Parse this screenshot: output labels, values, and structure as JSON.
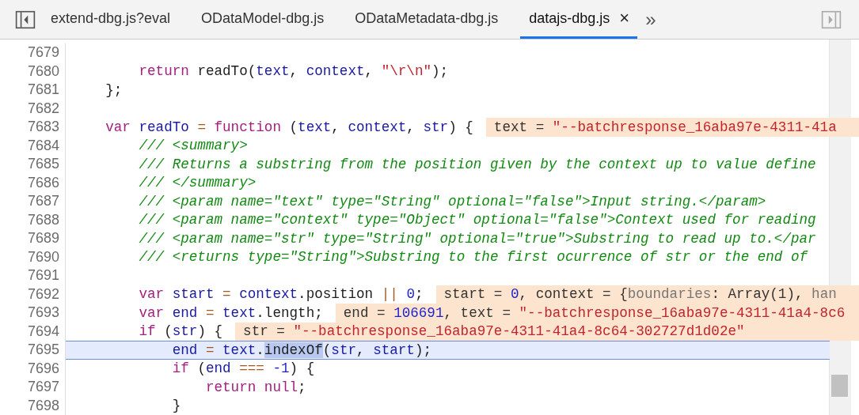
{
  "tabs": [
    {
      "label": "extend-dbg.js?eval",
      "selected": false
    },
    {
      "label": "ODataModel-dbg.js",
      "selected": false
    },
    {
      "label": "ODataMetadata-dbg.js",
      "selected": false
    },
    {
      "label": "datajs-dbg.js",
      "selected": true,
      "close": "×"
    }
  ],
  "overflow": "»",
  "lines": [
    {
      "number": "7679",
      "current": false
    },
    {
      "number": "7680",
      "current": false,
      "tokens": [
        {
          "kind": "kw",
          "text": "        return "
        },
        {
          "kind": "plain",
          "text": "readTo("
        },
        {
          "kind": "var",
          "text": "text"
        },
        {
          "kind": "plain",
          "text": ", "
        },
        {
          "kind": "var",
          "text": "context"
        },
        {
          "kind": "plain",
          "text": ", "
        },
        {
          "kind": "str",
          "text": "\"\\r\\n\""
        },
        {
          "kind": "plain",
          "text": ");"
        }
      ]
    },
    {
      "number": "7681",
      "current": false,
      "tokens": [
        {
          "kind": "plain",
          "text": "    };"
        }
      ]
    },
    {
      "number": "7682",
      "current": false
    },
    {
      "number": "7683",
      "current": false,
      "tokens": [
        {
          "kind": "kw",
          "text": "    var "
        },
        {
          "kind": "var",
          "text": "readTo "
        },
        {
          "kind": "op",
          "text": "= "
        },
        {
          "kind": "kw",
          "text": "function "
        },
        {
          "kind": "plain",
          "text": "("
        },
        {
          "kind": "var",
          "text": "text"
        },
        {
          "kind": "plain",
          "text": ", "
        },
        {
          "kind": "var",
          "text": "context"
        },
        {
          "kind": "plain",
          "text": ", "
        },
        {
          "kind": "var",
          "text": "str"
        },
        {
          "kind": "plain",
          "text": ") {"
        }
      ],
      "inline_value": [
        {
          "kind": "dark",
          "text": "text = "
        },
        {
          "kind": "str",
          "text": "\"--batchresponse_16aba97e-4311-41a"
        }
      ]
    },
    {
      "number": "7684",
      "current": false,
      "tokens": [
        {
          "kind": "com",
          "text": "        /// <summary>"
        }
      ]
    },
    {
      "number": "7685",
      "current": false,
      "tokens": [
        {
          "kind": "com",
          "text": "        /// Returns a substring from the position given by the context up to value define"
        }
      ]
    },
    {
      "number": "7686",
      "current": false,
      "tokens": [
        {
          "kind": "com",
          "text": "        /// </summary>"
        }
      ]
    },
    {
      "number": "7687",
      "current": false,
      "tokens": [
        {
          "kind": "com",
          "text": "        /// <param name=\"text\" type=\"String\" optional=\"false\">Input string.</param>"
        }
      ]
    },
    {
      "number": "7688",
      "current": false,
      "tokens": [
        {
          "kind": "com",
          "text": "        /// <param name=\"context\" type=\"Object\" optional=\"false\">Context used for reading"
        }
      ]
    },
    {
      "number": "7689",
      "current": false,
      "tokens": [
        {
          "kind": "com",
          "text": "        /// <param name=\"str\" type=\"String\" optional=\"true\">Substring to read up to.</par"
        }
      ]
    },
    {
      "number": "7690",
      "current": false,
      "tokens": [
        {
          "kind": "com",
          "text": "        /// <returns type=\"String\">Substring to the first ocurrence of str or the end of"
        }
      ]
    },
    {
      "number": "7691",
      "current": false
    },
    {
      "number": "7692",
      "current": false,
      "tokens": [
        {
          "kind": "kw",
          "text": "        var "
        },
        {
          "kind": "var",
          "text": "start "
        },
        {
          "kind": "op",
          "text": "= "
        },
        {
          "kind": "var",
          "text": "context"
        },
        {
          "kind": "plain",
          "text": ".position "
        },
        {
          "kind": "op",
          "text": "|| "
        },
        {
          "kind": "num",
          "text": "0"
        },
        {
          "kind": "plain",
          "text": ";"
        }
      ],
      "inline_value": [
        {
          "kind": "dark",
          "text": "start = "
        },
        {
          "kind": "num",
          "text": "0"
        },
        {
          "kind": "dark",
          "text": ", context = {"
        },
        {
          "kind": "dim",
          "text": "boundaries"
        },
        {
          "kind": "dark",
          "text": ": Array(1), "
        },
        {
          "kind": "dim",
          "text": "han"
        }
      ]
    },
    {
      "number": "7693",
      "current": false,
      "tokens": [
        {
          "kind": "kw",
          "text": "        var "
        },
        {
          "kind": "var",
          "text": "end "
        },
        {
          "kind": "op",
          "text": "= "
        },
        {
          "kind": "var",
          "text": "text"
        },
        {
          "kind": "plain",
          "text": ".length;"
        }
      ],
      "inline_value": [
        {
          "kind": "dark",
          "text": "end = "
        },
        {
          "kind": "num",
          "text": "106691"
        },
        {
          "kind": "dark",
          "text": ", text = "
        },
        {
          "kind": "str",
          "text": "\"--batchresponse_16aba97e-4311-41a4-8c6"
        }
      ]
    },
    {
      "number": "7694",
      "current": false,
      "tokens": [
        {
          "kind": "kw",
          "text": "        if "
        },
        {
          "kind": "plain",
          "text": "("
        },
        {
          "kind": "var",
          "text": "str"
        },
        {
          "kind": "plain",
          "text": ") {"
        }
      ],
      "inline_value": [
        {
          "kind": "dark",
          "text": "str = "
        },
        {
          "kind": "str",
          "text": "\"--batchresponse_16aba97e-4311-41a4-8c64-302727d1d02e\""
        }
      ]
    },
    {
      "number": "7695",
      "current": true,
      "tokens": [
        {
          "kind": "var",
          "text": "            end "
        },
        {
          "kind": "op",
          "text": "= "
        },
        {
          "kind": "var",
          "text": "text"
        },
        {
          "kind": "plain",
          "text": "."
        },
        {
          "kind": "match",
          "text": "indexOf"
        },
        {
          "kind": "plain",
          "text": "("
        },
        {
          "kind": "var",
          "text": "str"
        },
        {
          "kind": "plain",
          "text": ", "
        },
        {
          "kind": "var",
          "text": "start"
        },
        {
          "kind": "plain",
          "text": ");"
        }
      ]
    },
    {
      "number": "7696",
      "current": false,
      "tokens": [
        {
          "kind": "kw",
          "text": "            if "
        },
        {
          "kind": "plain",
          "text": "("
        },
        {
          "kind": "var",
          "text": "end "
        },
        {
          "kind": "op",
          "text": "=== "
        },
        {
          "kind": "num",
          "text": "-1"
        },
        {
          "kind": "plain",
          "text": ") "
        },
        {
          "kind": "brace",
          "text": "{"
        }
      ]
    },
    {
      "number": "7697",
      "current": false,
      "tokens": [
        {
          "kind": "kw",
          "text": "                return null"
        },
        {
          "kind": "plain",
          "text": ";"
        }
      ]
    },
    {
      "number": "7698",
      "current": false,
      "tokens": [
        {
          "kind": "brace",
          "text": "            }"
        }
      ]
    }
  ]
}
